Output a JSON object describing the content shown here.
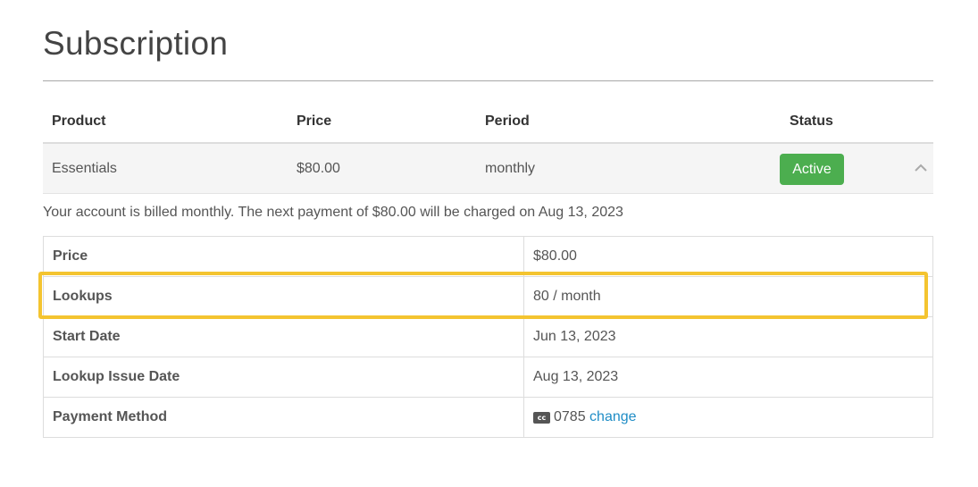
{
  "page": {
    "title": "Subscription"
  },
  "subscription_table": {
    "headers": {
      "product": "Product",
      "price": "Price",
      "period": "Period",
      "status": "Status"
    },
    "row": {
      "product": "Essentials",
      "price": "$80.00",
      "period": "monthly",
      "status": "Active",
      "status_color": "#4cae4f",
      "toggle_icon": "chevron-up-icon"
    }
  },
  "billing_note": "Your account is billed monthly. The next payment of $80.00 will be charged on Aug 13, 2023",
  "details": {
    "price": {
      "label": "Price",
      "value": "$80.00"
    },
    "lookups": {
      "label": "Lookups",
      "value": "80 / month"
    },
    "start_date": {
      "label": "Start Date",
      "value": "Jun 13, 2023"
    },
    "lookup_issue_date": {
      "label": "Lookup Issue Date",
      "value": "Aug 13, 2023"
    },
    "payment_method": {
      "label": "Payment Method",
      "card_icon": "credit-card-icon",
      "card_icon_text": "cc",
      "card_last4": "0785",
      "change_label": "change"
    }
  },
  "highlight_color": "#f4c430",
  "link_color": "#1f8dc6"
}
